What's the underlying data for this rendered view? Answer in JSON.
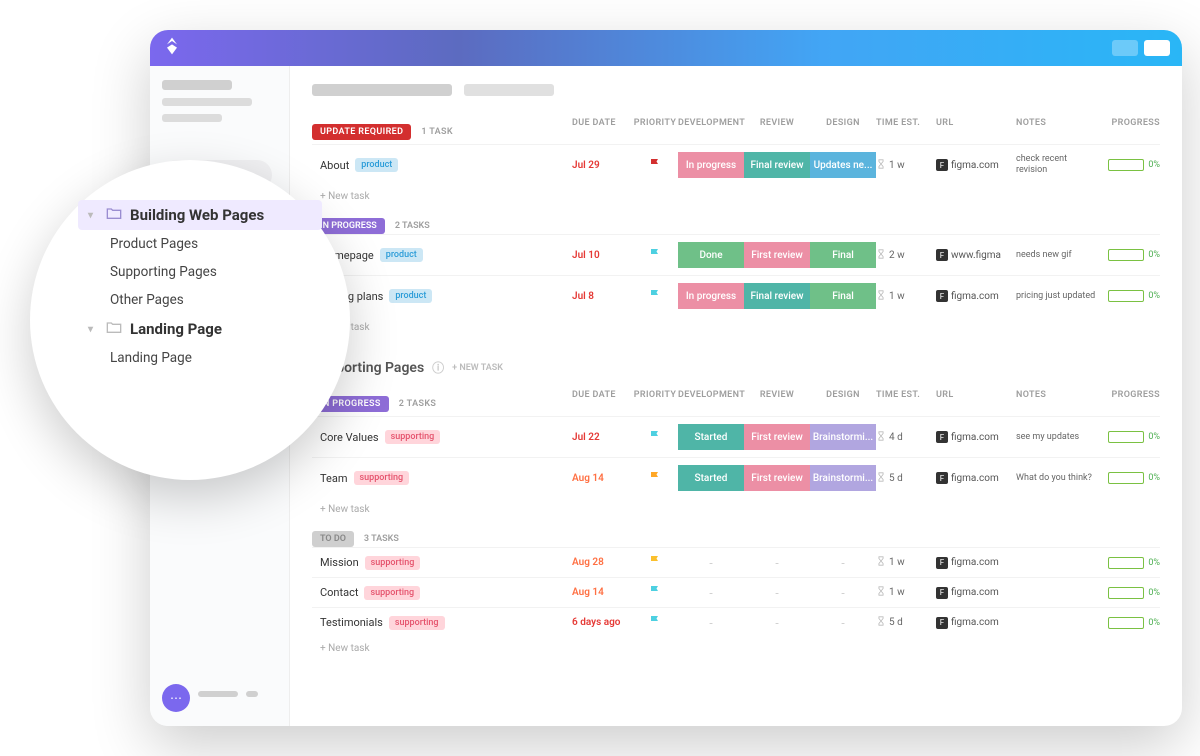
{
  "columns": {
    "due": "DUE DATE",
    "priority": "PRIORITY",
    "dev": "DEVELOPMENT",
    "review": "REVIEW",
    "design": "DESIGN",
    "time": "TIME EST.",
    "url": "URL",
    "notes": "NOTES",
    "progress": "PROGRESS"
  },
  "section1": {
    "status": {
      "label": "UPDATE REQUIRED",
      "count": "1 TASK"
    },
    "rows": [
      {
        "name": "About",
        "tag": "product",
        "due": "Jul 29",
        "flag": "red",
        "stages": {
          "dev": {
            "label": "In progress",
            "cls": "stage-pink"
          },
          "review": {
            "label": "Final review",
            "cls": "stage-teal"
          },
          "design": {
            "label": "Updates ne...",
            "cls": "stage-blue"
          }
        },
        "time": "1 w",
        "url": "figma.com",
        "notes": "check recent revision",
        "progress": "0%"
      }
    ]
  },
  "section2": {
    "status": {
      "label": "IN PROGRESS",
      "count": "2 TASKS"
    },
    "rows": [
      {
        "name": "Homepage",
        "tag": "product",
        "due": "Jul 10",
        "flag": "cyan",
        "stages": {
          "dev": {
            "label": "Done",
            "cls": "stage-green"
          },
          "review": {
            "label": "First review",
            "cls": "stage-pink"
          },
          "design": {
            "label": "Final",
            "cls": "stage-green"
          }
        },
        "time": "2 w",
        "url": "www.figma",
        "notes": "needs new gif",
        "progress": "0%"
      },
      {
        "name": "Pricing plans",
        "tag": "product",
        "due": "Jul 8",
        "flag": "cyan",
        "stages": {
          "dev": {
            "label": "In progress",
            "cls": "stage-pink"
          },
          "review": {
            "label": "Final review",
            "cls": "stage-teal"
          },
          "design": {
            "label": "Final",
            "cls": "stage-green"
          }
        },
        "time": "1 w",
        "url": "figma.com",
        "notes": "pricing just updated",
        "progress": "0%"
      }
    ]
  },
  "group2": {
    "title": "Supporting Pages",
    "newtask": "+ NEW TASK"
  },
  "section3": {
    "status": {
      "label": "IN PROGRESS",
      "count": "2 TASKS"
    },
    "rows": [
      {
        "name": "Core Values",
        "tag": "supporting",
        "due": "Jul 22",
        "flag": "cyan",
        "stages": {
          "dev": {
            "label": "Started",
            "cls": "stage-teal"
          },
          "review": {
            "label": "First review",
            "cls": "stage-pink"
          },
          "design": {
            "label": "Brainstormi...",
            "cls": "stage-lav"
          }
        },
        "time": "4 d",
        "url": "figma.com",
        "notes": "see my updates",
        "progress": "0%"
      },
      {
        "name": "Team",
        "tag": "supporting",
        "due": "Aug 14",
        "flag": "orange",
        "stages": {
          "dev": {
            "label": "Started",
            "cls": "stage-teal"
          },
          "review": {
            "label": "First review",
            "cls": "stage-pink"
          },
          "design": {
            "label": "Brainstormi...",
            "cls": "stage-lav"
          }
        },
        "time": "5 d",
        "url": "figma.com",
        "notes": "What do you think?",
        "progress": "0%"
      }
    ]
  },
  "section4": {
    "status": {
      "label": "TO DO",
      "count": "3 TASKS"
    },
    "rows": [
      {
        "name": "Mission",
        "tag": "supporting",
        "due": "Aug 28",
        "flag": "yellow",
        "time": "1 w",
        "url": "figma.com",
        "notes": "",
        "progress": "0%"
      },
      {
        "name": "Contact",
        "tag": "supporting",
        "due": "Aug 14",
        "flag": "cyan",
        "time": "1 w",
        "url": "figma.com",
        "notes": "",
        "progress": "0%"
      },
      {
        "name": "Testimonials",
        "tag": "supporting",
        "due": "6 days ago",
        "flag": "cyan",
        "time": "5 d",
        "url": "figma.com",
        "notes": "",
        "progress": "0%"
      }
    ]
  },
  "newtask": "+ New task",
  "magnify": {
    "building": "Building Web Pages",
    "items1": [
      "Product Pages",
      "Supporting Pages",
      "Other Pages"
    ],
    "landing": "Landing Page",
    "items2": [
      "Landing Page"
    ]
  },
  "flagColors": {
    "red": "#d32f2f",
    "cyan": "#4dd0e1",
    "yellow": "#fbc02d",
    "orange": "#ffa726"
  },
  "dueColors": {
    "Jul 29": "#e53935",
    "Jul 10": "#e53935",
    "Jul 8": "#e53935",
    "Jul 22": "#e53935",
    "Aug 14": "#ff7043",
    "Aug 28": "#ff7043",
    "6 days ago": "#e53935"
  }
}
